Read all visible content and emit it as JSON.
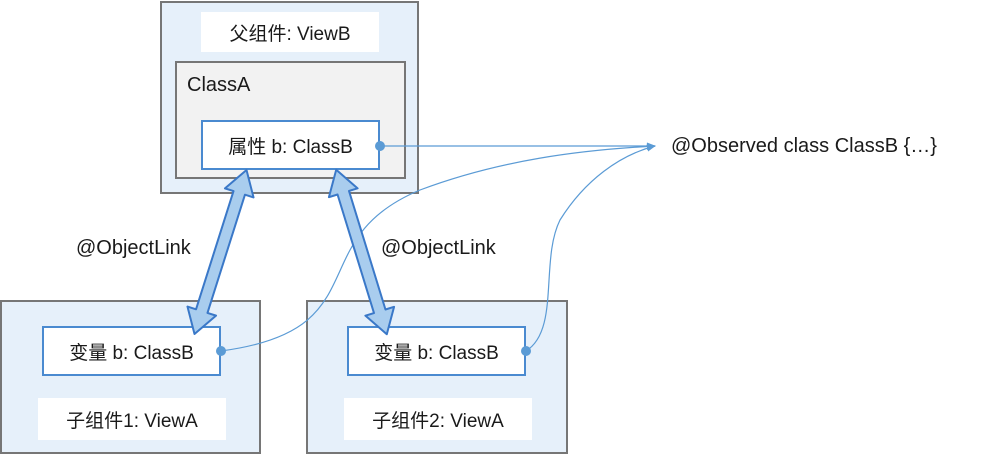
{
  "parent": {
    "title": "父组件: ViewB",
    "class_box": {
      "title": "ClassA",
      "property": "属性 b: ClassB"
    }
  },
  "children": [
    {
      "variable": "变量 b: ClassB",
      "title": "子组件1: ViewA"
    },
    {
      "variable": "变量 b: ClassB",
      "title": "子组件2: ViewA"
    }
  ],
  "links": {
    "left": "@ObjectLink",
    "right": "@ObjectLink"
  },
  "observed": "@Observed class ClassB {…}",
  "colors": {
    "outer_fill": "#e6f0fa",
    "border_grey": "#767676",
    "field_border": "#4a8ad0",
    "arrow_fill": "#a9cdee",
    "arrow_stroke": "#3a78c8",
    "connector": "#5b9bd5"
  }
}
